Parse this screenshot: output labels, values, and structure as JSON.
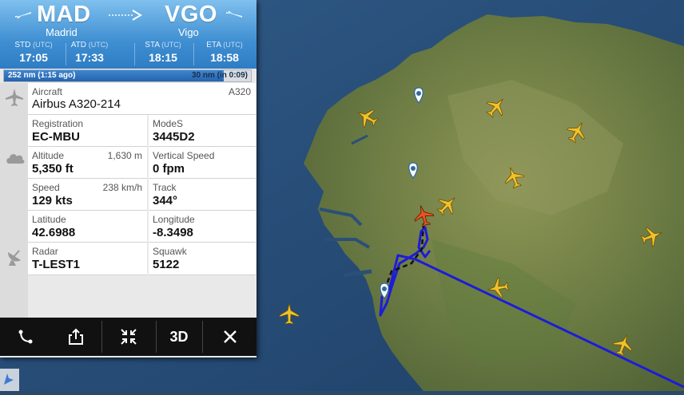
{
  "route": {
    "origin_code": "MAD",
    "origin_city": "Madrid",
    "dest_code": "VGO",
    "dest_city": "Vigo"
  },
  "times": [
    {
      "label": "STD",
      "unit": "(UTC)",
      "value": "17:05"
    },
    {
      "label": "ATD",
      "unit": "(UTC)",
      "value": "17:33"
    },
    {
      "label": "STA",
      "unit": "(UTC)",
      "value": "18:15"
    },
    {
      "label": "ETA",
      "unit": "(UTC)",
      "value": "18:58"
    }
  ],
  "progress": {
    "left_text": "252 nm (1:15 ago)",
    "right_text": "30 nm (in 0:09)",
    "fraction_complete": 0.89
  },
  "details": {
    "aircraft": {
      "label": "Aircraft",
      "value": "Airbus A320-214",
      "aux": "A320"
    },
    "registration": {
      "label": "Registration",
      "value": "EC-MBU"
    },
    "modes": {
      "label": "ModeS",
      "value": "3445D2"
    },
    "altitude": {
      "label": "Altitude",
      "value": "5,350 ft",
      "aux": "1,630 m"
    },
    "vertical_speed": {
      "label": "Vertical Speed",
      "value": "0 fpm"
    },
    "speed": {
      "label": "Speed",
      "value": "129 kts",
      "aux": "238 km/h"
    },
    "track": {
      "label": "Track",
      "value": "344°"
    },
    "latitude": {
      "label": "Latitude",
      "value": "42.6988"
    },
    "longitude": {
      "label": "Longitude",
      "value": "-8.3498"
    },
    "radar": {
      "label": "Radar",
      "value": "T-LEST1"
    },
    "squawk": {
      "label": "Squawk",
      "value": "5122"
    }
  },
  "toolbar": {
    "route_icon": "route-icon",
    "share_icon": "share-icon",
    "collapse_icon": "collapse-icon",
    "three_d_label": "3D",
    "close_icon": "close-icon"
  },
  "colors": {
    "header_blue": "#3f8fd2",
    "flight_path": "#1c1cd8",
    "selected_plane": "#e8531f",
    "other_planes": "#f2c12a"
  }
}
